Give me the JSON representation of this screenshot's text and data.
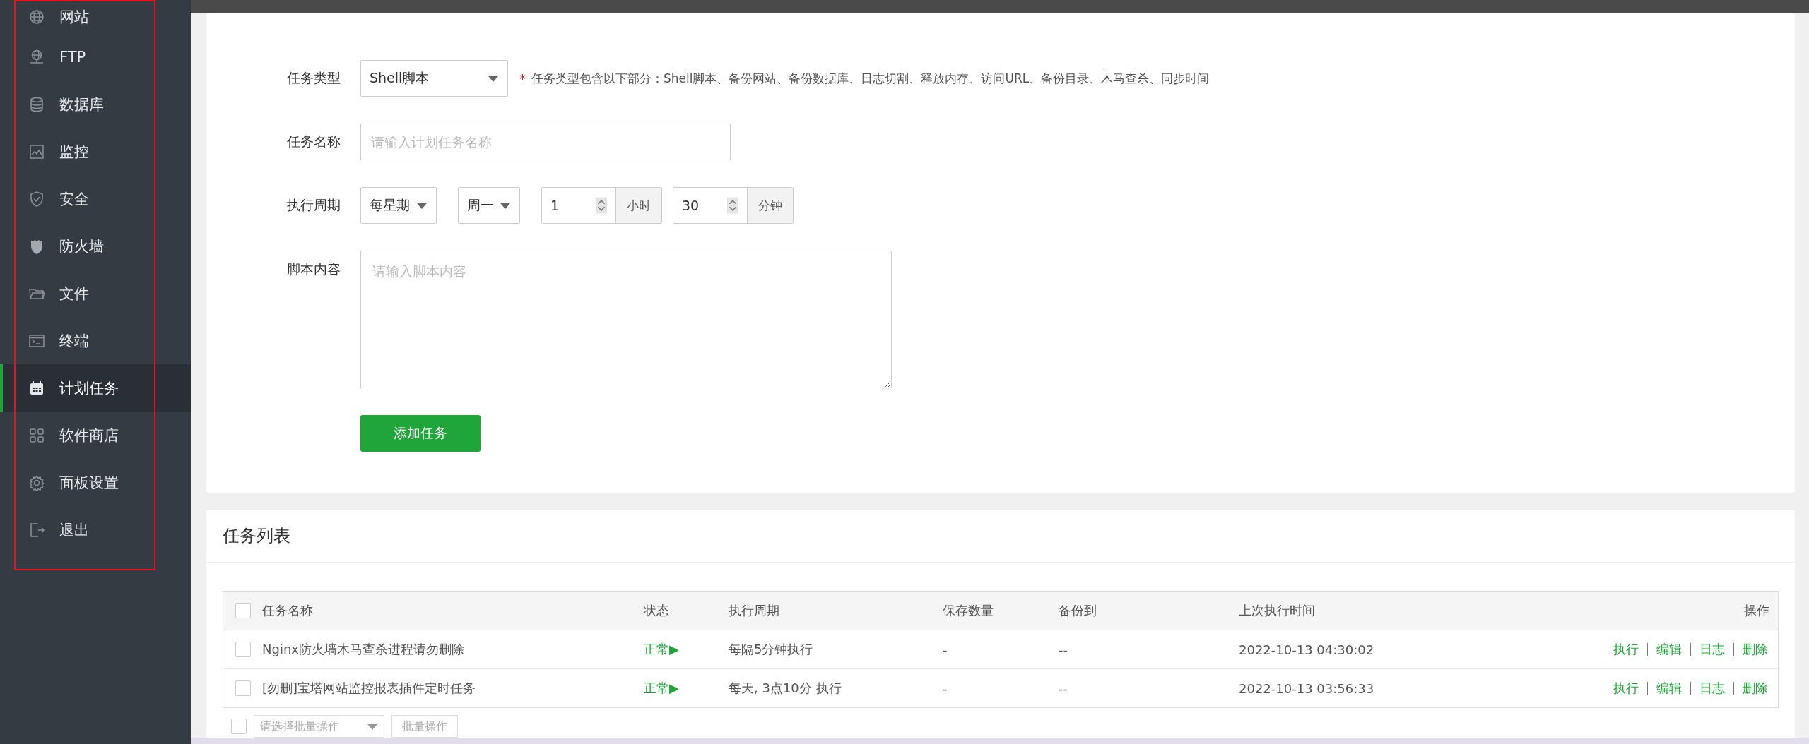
{
  "sidebar": {
    "items": [
      {
        "label": "网站",
        "kind": "globe",
        "selected": false
      },
      {
        "label": "FTP",
        "kind": "ftp",
        "selected": false
      },
      {
        "label": "数据库",
        "kind": "database",
        "selected": false
      },
      {
        "label": "监控",
        "kind": "monitor",
        "selected": false
      },
      {
        "label": "安全",
        "kind": "shield",
        "selected": false
      },
      {
        "label": "防火墙",
        "kind": "firewall",
        "selected": false
      },
      {
        "label": "文件",
        "kind": "folder",
        "selected": false
      },
      {
        "label": "终端",
        "kind": "terminal",
        "selected": false
      },
      {
        "label": "计划任务",
        "kind": "calendar",
        "selected": true
      },
      {
        "label": "软件商店",
        "kind": "grid",
        "selected": false
      },
      {
        "label": "面板设置",
        "kind": "gear",
        "selected": false
      },
      {
        "label": "退出",
        "kind": "exit",
        "selected": false
      }
    ]
  },
  "form": {
    "task_type": {
      "label": "任务类型",
      "value": "Shell脚本",
      "required_mark": "*",
      "hint": "任务类型包含以下部分：Shell脚本、备份网站、备份数据库、日志切割、释放内存、访问URL、备份目录、木马查杀、同步时间"
    },
    "task_name": {
      "label": "任务名称",
      "placeholder": "请输入计划任务名称"
    },
    "cycle": {
      "label": "执行周期",
      "period": "每星期",
      "weekday": "周一",
      "hour": "1",
      "hour_unit": "小时",
      "minute": "30",
      "minute_unit": "分钟"
    },
    "script": {
      "label": "脚本内容",
      "placeholder": "请输入脚本内容"
    },
    "submit": "添加任务"
  },
  "task_list": {
    "title": "任务列表",
    "select_all_checked": false,
    "columns": [
      "任务名称",
      "状态",
      "执行周期",
      "保存数量",
      "备份到",
      "上次执行时间",
      "操作"
    ],
    "rows": [
      {
        "checked": false,
        "name": "Nginx防火墙木马查杀进程请勿删除",
        "status": "正常▶",
        "cycle": "每隔5分钟执行",
        "keep": "-",
        "backup": "--",
        "last_run": "2022-10-13 04:30:02",
        "actions": [
          "执行",
          "编辑",
          "日志",
          "删除"
        ]
      },
      {
        "checked": false,
        "name": "[勿删]宝塔网站监控报表插件定时任务",
        "status": "正常▶",
        "cycle": "每天, 3点10分 执行",
        "keep": "-",
        "backup": "--",
        "last_run": "2022-10-13 03:56:33",
        "actions": [
          "执行",
          "编辑",
          "日志",
          "删除"
        ]
      }
    ],
    "batch_checked": false,
    "batch_select": {
      "placeholder": "请选择批量操作"
    },
    "batch_button": "批量操作"
  }
}
